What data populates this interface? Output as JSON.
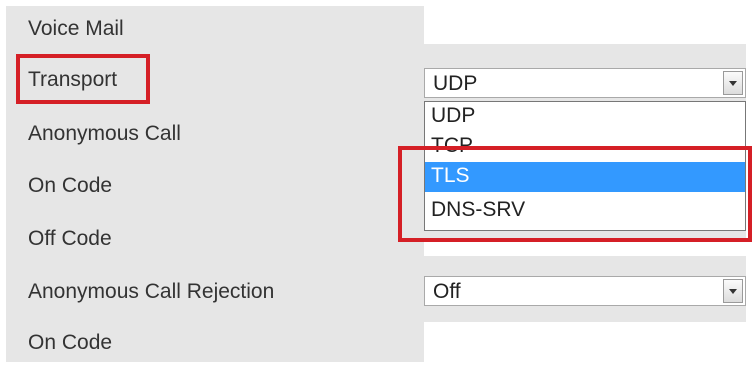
{
  "labels": {
    "voice_mail": "Voice Mail",
    "transport": "Transport",
    "anonymous_call": "Anonymous Call",
    "on_code_1": "On Code",
    "off_code": "Off Code",
    "anonymous_call_rejection": "Anonymous Call Rejection",
    "on_code_2": "On Code"
  },
  "transport_select": {
    "value": "UDP",
    "options": [
      "UDP",
      "TCP",
      "TLS",
      "DNS-SRV"
    ],
    "highlighted": "TLS"
  },
  "rejection_select": {
    "value": "Off"
  },
  "colors": {
    "panel_bg": "#e6e6e6",
    "highlight_blue": "#3399ff",
    "callout_red": "#d51f26"
  }
}
